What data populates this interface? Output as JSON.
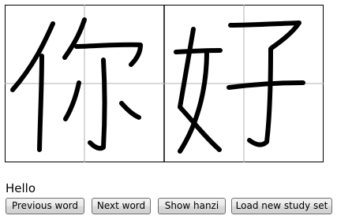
{
  "flashcard": {
    "hanzi": "你好",
    "translation": "Hello"
  },
  "buttons": {
    "previous_label": "Previous word",
    "next_label": "Next word",
    "show_hanzi_label": "Show hanzi",
    "load_label": "Load new study set"
  }
}
